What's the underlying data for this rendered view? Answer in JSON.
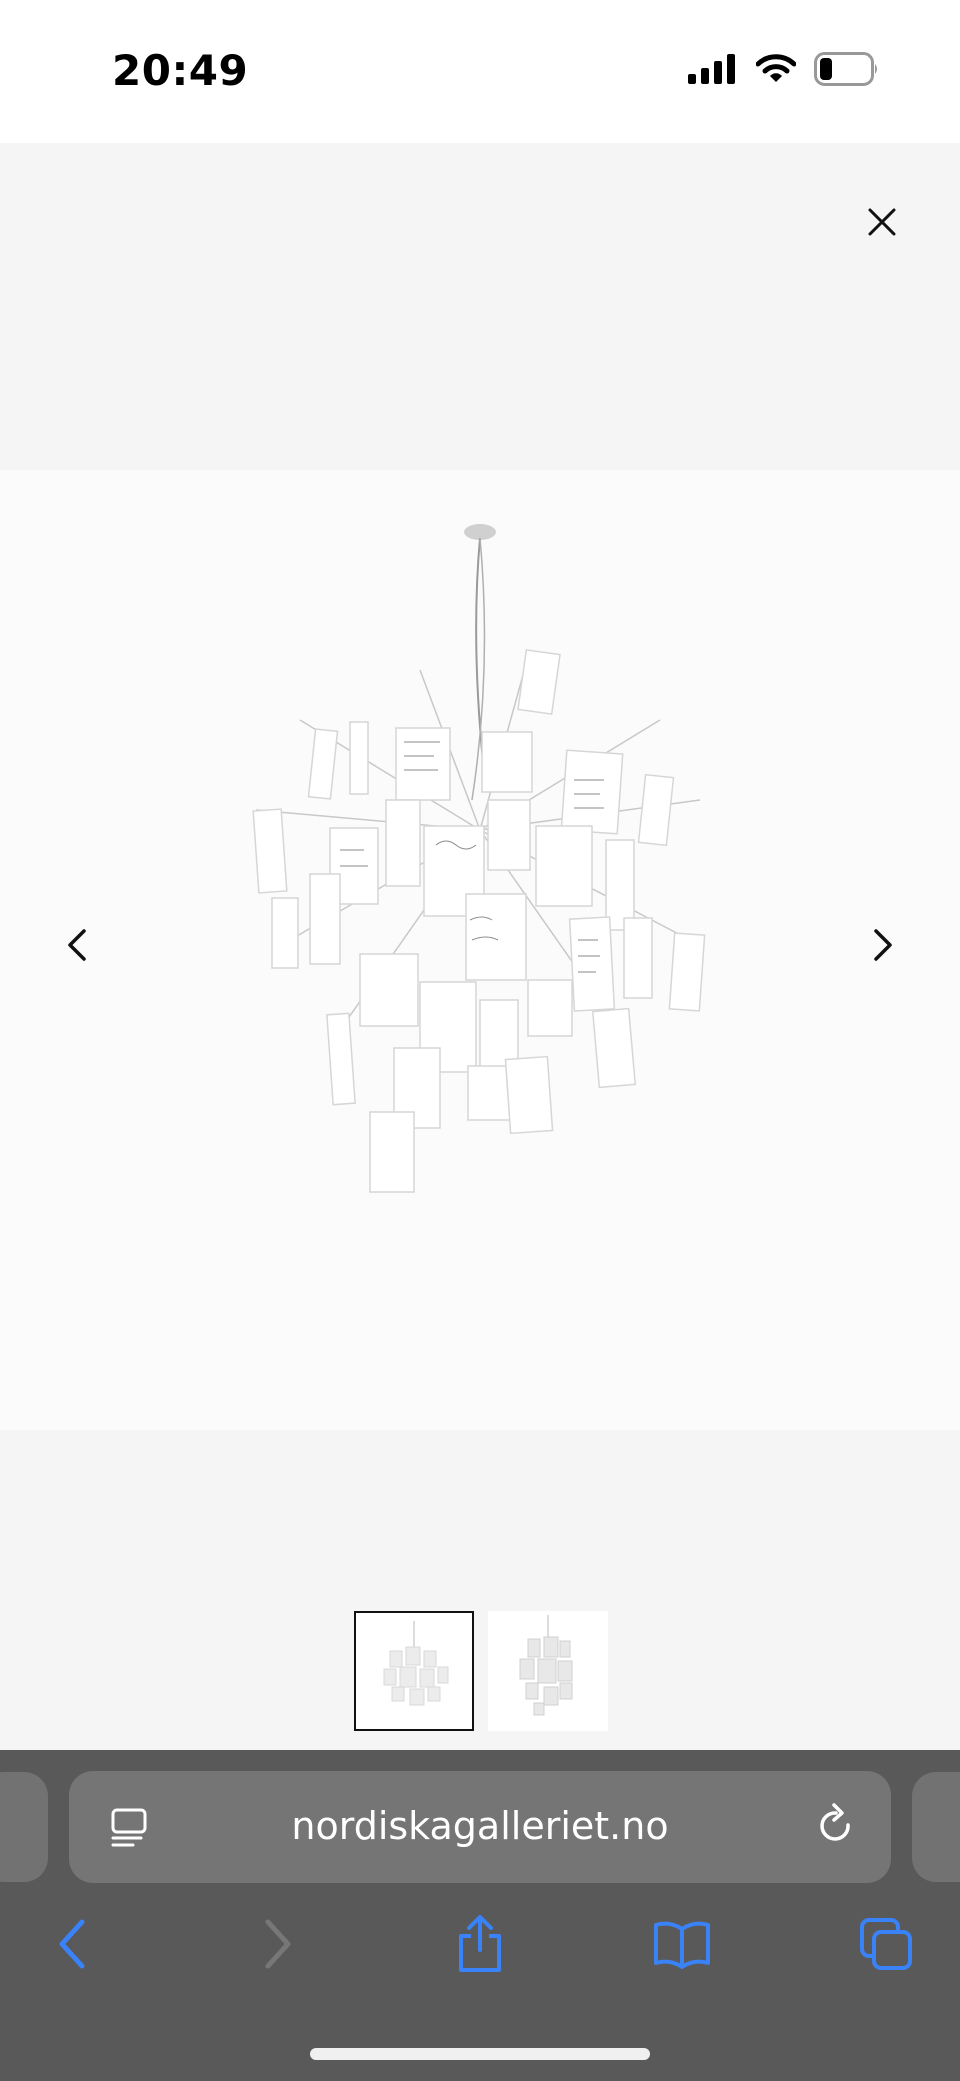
{
  "status_bar": {
    "time": "20:49",
    "icons": [
      "cellular-signal-icon",
      "wifi-icon",
      "battery-icon"
    ]
  },
  "gallery": {
    "main_image": "chandelier-paper-notes",
    "thumbnails": [
      {
        "name": "chandelier-thumbnail-front",
        "selected": true
      },
      {
        "name": "chandelier-thumbnail-side",
        "selected": false
      }
    ],
    "controls": [
      "close-icon",
      "chevron-left-icon",
      "chevron-right-icon"
    ]
  },
  "browser": {
    "url": "nordiskagalleriet.no",
    "toolbar_icons": [
      "back-icon",
      "forward-icon",
      "share-icon",
      "bookmarks-icon",
      "tabs-icon"
    ],
    "accent_color": "#3a82f7"
  }
}
